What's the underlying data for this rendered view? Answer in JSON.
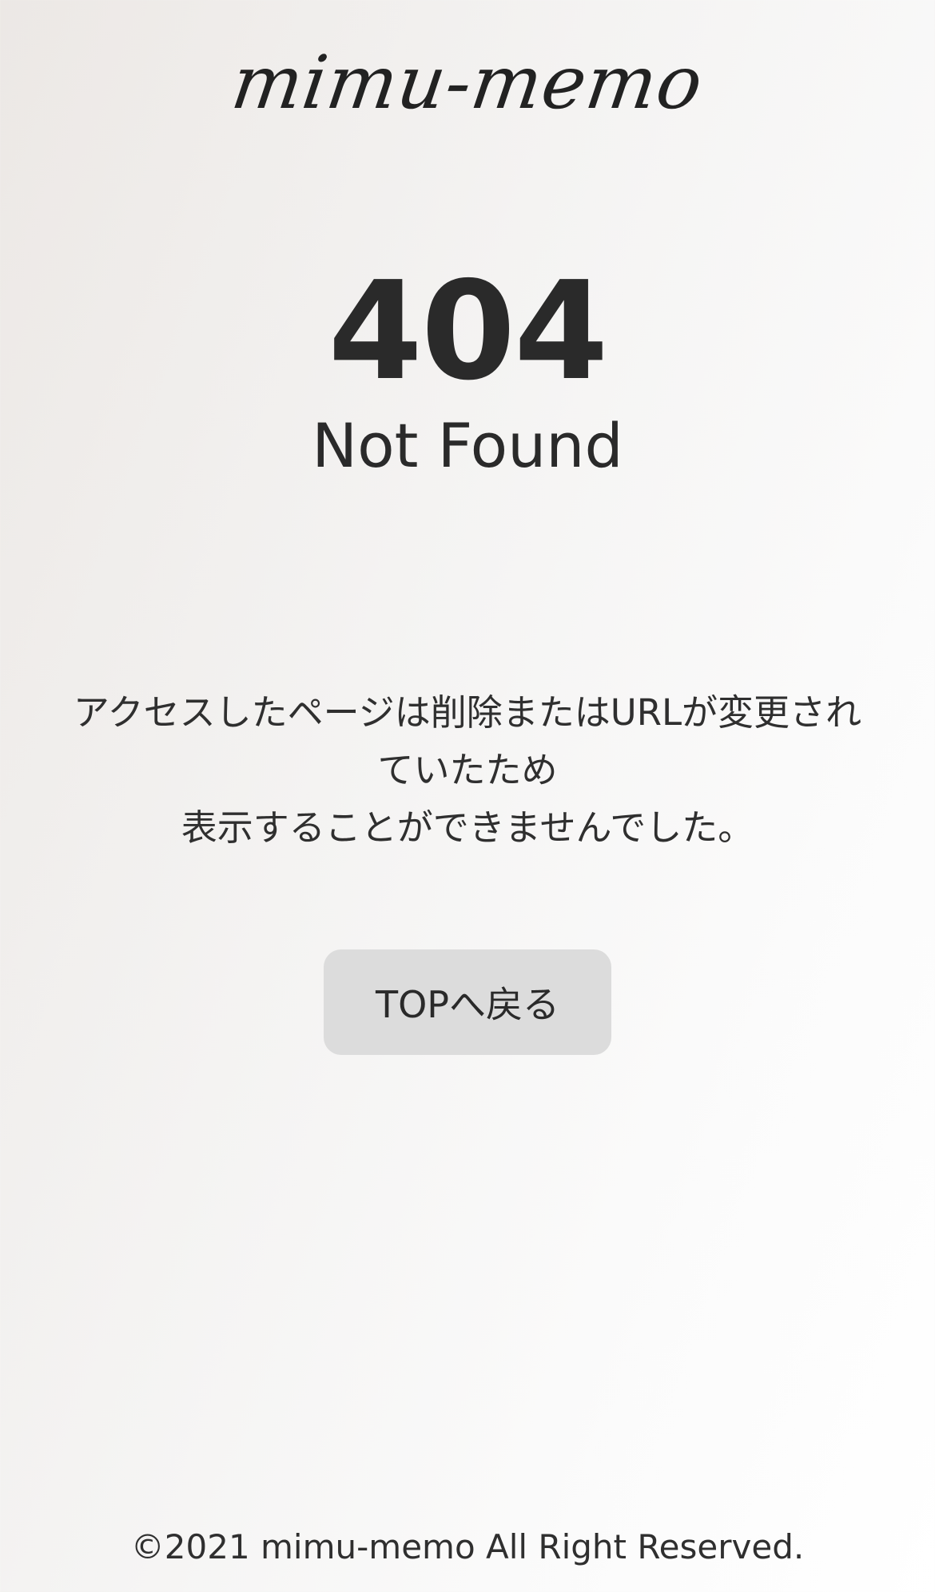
{
  "header": {
    "logo_text": "mimu-memo"
  },
  "error": {
    "code": "404",
    "title": "Not Found",
    "message_lines": [
      "アクセスしたページは削除またはURLが変更され",
      "ていたため",
      "表示することができませんでした。"
    ]
  },
  "actions": {
    "top_button_label": "TOPへ戻る"
  },
  "footer": {
    "copyright": "©2021 mimu-memo All Right Reserved."
  },
  "colors": {
    "text": "#2b2b2b",
    "button_bg": "#dcdcdc"
  }
}
